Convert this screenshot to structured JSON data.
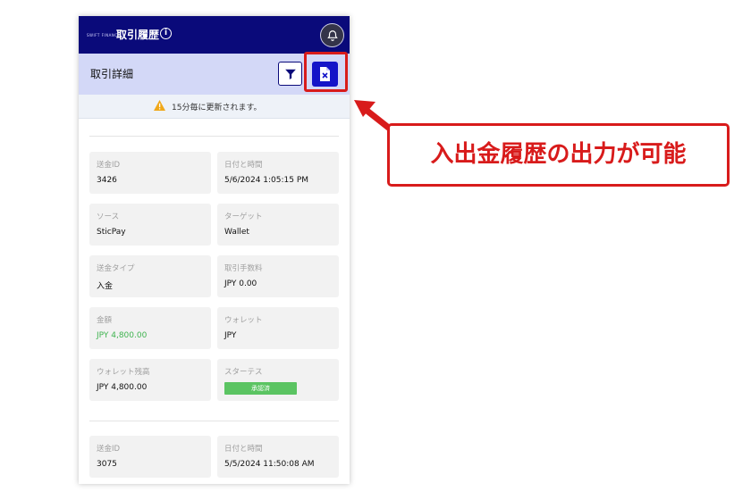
{
  "header": {
    "logo_text": "SWIFT FINANCE",
    "title": "取引履歴",
    "info_icon": "info-icon",
    "notification_icon": "bell-icon"
  },
  "subheader": {
    "title": "取引詳細",
    "filter_icon": "filter-icon",
    "export_icon": "export-file-icon"
  },
  "notice": {
    "icon": "warning-icon",
    "text": "15分毎に更新されます。"
  },
  "transactions": [
    {
      "fields": [
        {
          "label": "送金ID",
          "value": "3426"
        },
        {
          "label": "日付と時間",
          "value": "5/6/2024 1:05:15 PM"
        },
        {
          "label": "ソース",
          "value": "SticPay"
        },
        {
          "label": "ターゲット",
          "value": "Wallet"
        },
        {
          "label": "送金タイプ",
          "value": "入金"
        },
        {
          "label": "取引手数料",
          "value": "JPY 0.00"
        },
        {
          "label": "金額",
          "value": "JPY 4,800.00"
        },
        {
          "label": "ウォレット",
          "value": "JPY"
        },
        {
          "label": "ウォレット残高",
          "value": "JPY 4,800.00"
        },
        {
          "label": "スターテス",
          "value": "承認済"
        }
      ]
    },
    {
      "fields": [
        {
          "label": "送金ID",
          "value": "3075"
        },
        {
          "label": "日付と時間",
          "value": "5/5/2024 11:50:08 AM"
        }
      ]
    }
  ],
  "annotation": {
    "callout_text": "入出金履歴の出力が可能"
  },
  "colors": {
    "header_bg": "#0a0a7a",
    "subheader_bg": "#d3d8f7",
    "accent_button": "#1414c8",
    "amount_green": "#3fb34f",
    "status_badge": "#5bc462",
    "annotation_red": "#d81b1b"
  }
}
